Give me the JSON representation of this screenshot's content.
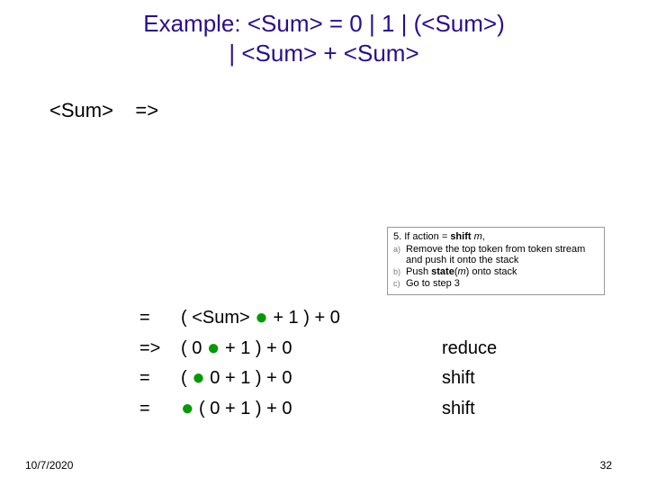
{
  "title": {
    "line1": "Example: <Sum> = 0 | 1 | (<Sum>)",
    "line2": "| <Sum> + <Sum>"
  },
  "body": {
    "lhs": "<Sum>",
    "arrow": "=>"
  },
  "info": {
    "num": "5.",
    "main": "If action = ",
    "shift_word": "shift",
    "m_italic": " m",
    "comma": ",",
    "a_letter": "a)",
    "a_text": "Remove the top token from token stream and push it onto the stack",
    "b_letter": "b)",
    "b_text_1": "Push ",
    "b_text_state": "state",
    "b_text_2": "(",
    "b_text_m": "m",
    "b_text_3": ") onto stack",
    "c_letter": "c)",
    "c_text": "Go to step 3"
  },
  "steps": [
    {
      "op": "=",
      "pre": "( <Sum> ",
      "post": " + 1 ) + 0",
      "action": ""
    },
    {
      "op": "=>",
      "pre": "( 0 ",
      "post": " + 1 ) + 0",
      "action": "reduce"
    },
    {
      "op": "=",
      "pre": "( ",
      "post": " 0 + 1 ) + 0",
      "action": "shift"
    },
    {
      "op": "=",
      "pre": "",
      "post": " ( 0 + 1 ) + 0",
      "action": "shift"
    }
  ],
  "footer": {
    "date": "10/7/2020",
    "page": "32"
  }
}
